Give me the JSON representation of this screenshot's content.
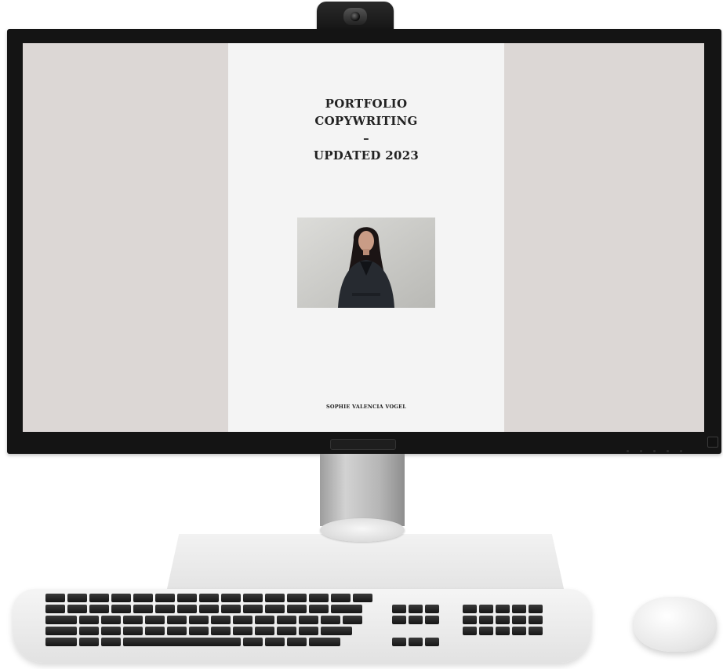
{
  "document": {
    "title_lines": [
      "PORTFOLIO",
      "COPYWRITING",
      "–",
      "UPDATED 2023"
    ],
    "author": "SOPHIE VALENCIA VOGEL"
  },
  "colors": {
    "screen_background": "#dcd7d5",
    "page_background": "#f4f4f4",
    "bezel": "#141414",
    "text": "#222222"
  }
}
